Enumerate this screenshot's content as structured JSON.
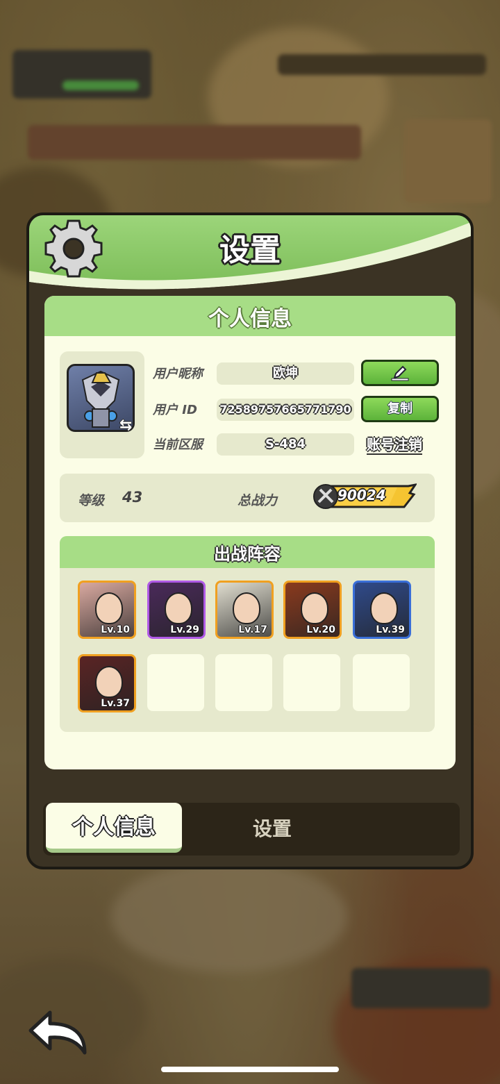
{
  "panel": {
    "title": "设置"
  },
  "profile_card": {
    "title": "个人信息",
    "nickname_label": "用户昵称",
    "nickname_value": "欧坤",
    "user_id_label": "用户 ID",
    "user_id_value": "72589757665771790",
    "copy_button": "复制",
    "server_label": "当前区服",
    "server_value": "S-484",
    "account_cancel_link": "账号注销"
  },
  "stats": {
    "level_label": "等级",
    "level_value": "43",
    "power_label": "总战力",
    "power_value": "90024"
  },
  "lineup": {
    "title": "出战阵容",
    "heroes": [
      {
        "level": "Lv.10",
        "frame": "#f0a020",
        "art": "#d9a9a0"
      },
      {
        "level": "Lv.29",
        "frame": "#b05ae6",
        "art": "#4a2a5a"
      },
      {
        "level": "Lv.17",
        "frame": "#f0a020",
        "art": "#e0ddcf"
      },
      {
        "level": "Lv.20",
        "frame": "#f0a020",
        "art": "#8a3a1e"
      },
      {
        "level": "Lv.39",
        "frame": "#3a6fd8",
        "art": "#2f4a8a"
      },
      {
        "level": "Lv.37",
        "frame": "#f0a020",
        "art": "#5a2424"
      }
    ],
    "empty_slots": 4
  },
  "tabs": {
    "active": "个人信息",
    "other": "设置"
  },
  "colors": {
    "header_green": "#9cd57a",
    "card_bg": "#fbfde6",
    "button_green": "#5cb33a",
    "power_yellow": "#f5c431"
  }
}
